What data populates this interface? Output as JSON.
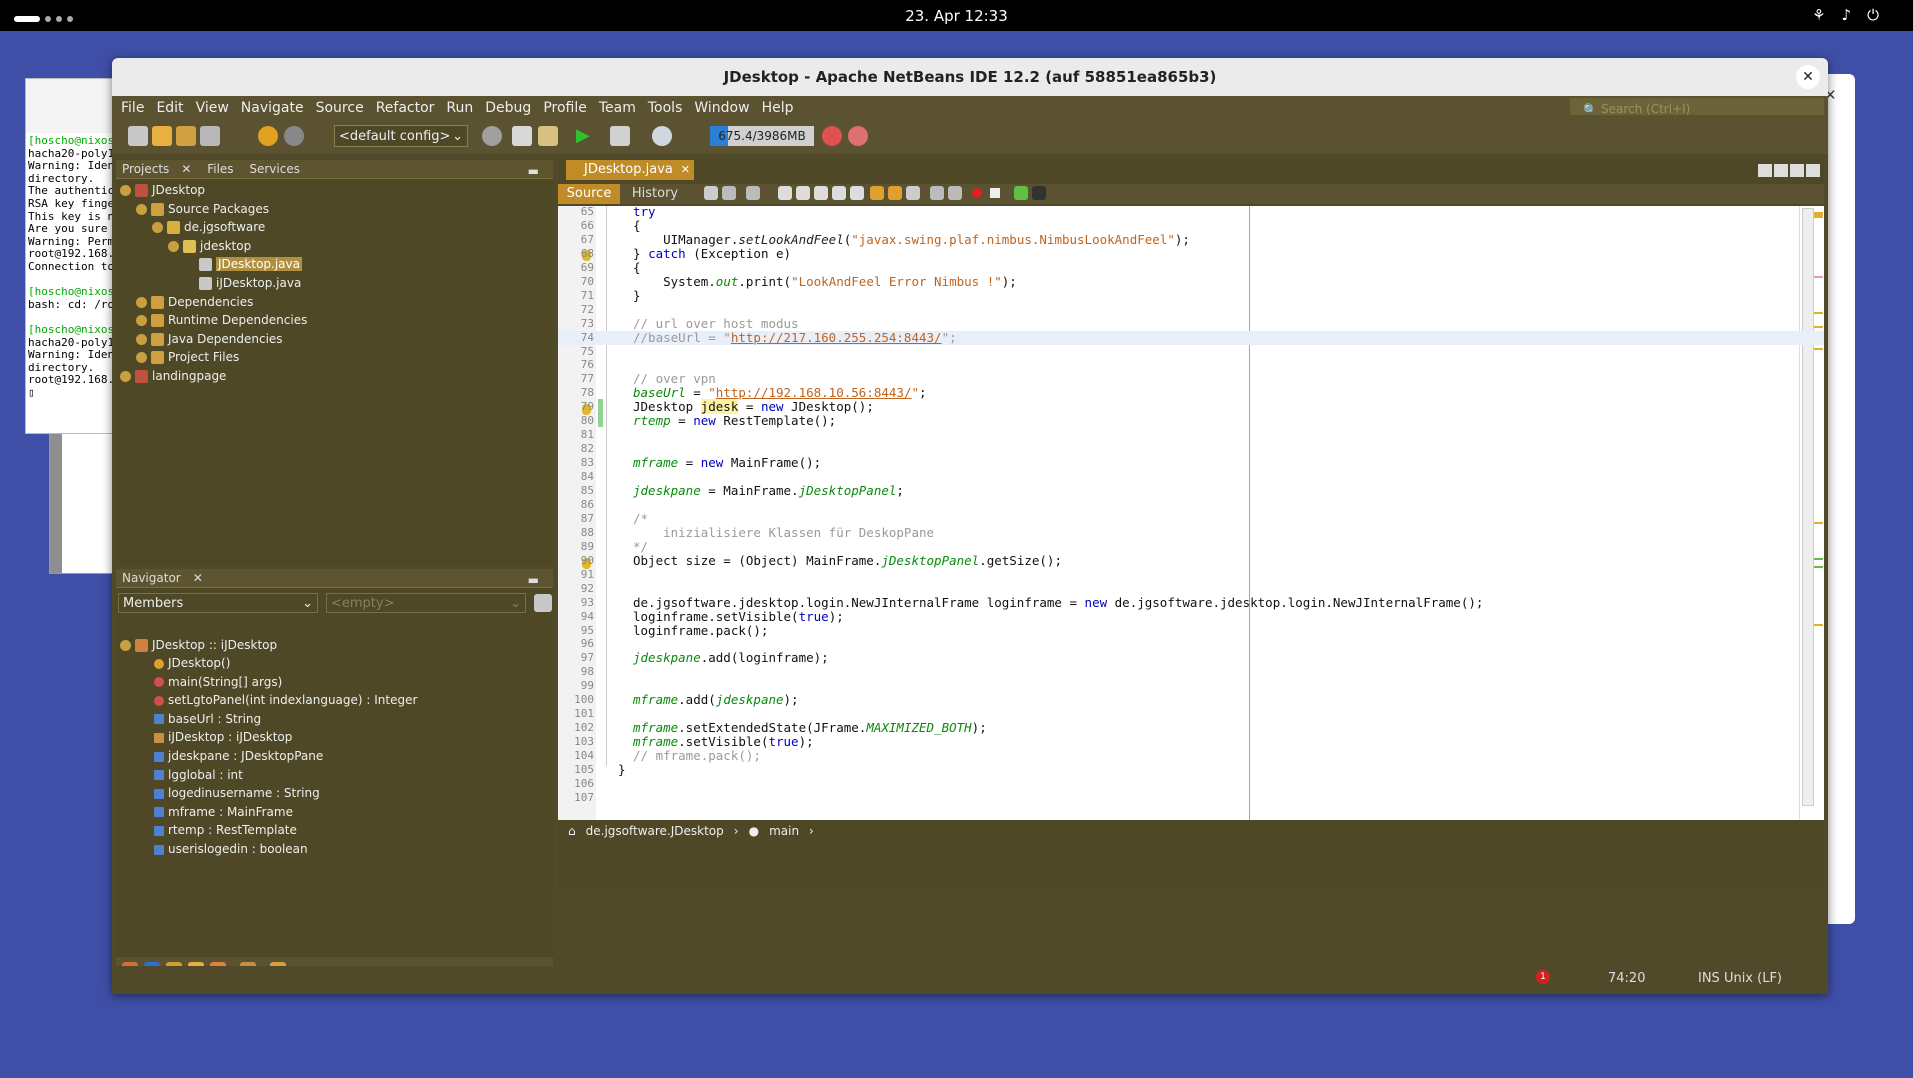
{
  "system_bar": {
    "clock": "23. Apr  12:33"
  },
  "terminal": {
    "lines": [
      {
        "text": "[hoscho@nixos:",
        "green": true
      },
      {
        "text": "hacha20-poly13",
        "green": false
      },
      {
        "text": "Warning: Ident",
        "green": false
      },
      {
        "text": "directory.",
        "green": false
      },
      {
        "text": "The authentici",
        "green": false
      },
      {
        "text": "RSA key finger",
        "green": false
      },
      {
        "text": "This key is no",
        "green": false
      },
      {
        "text": "Are you sure y",
        "green": false
      },
      {
        "text": "Warning: Perma",
        "green": false
      },
      {
        "text": "root@192.168.1",
        "green": false
      },
      {
        "text": "Connection to ",
        "green": false
      },
      {
        "text": "",
        "green": false
      },
      {
        "text": "[hoscho@nixos:",
        "green": true
      },
      {
        "text": "bash: cd: /roo",
        "green": false
      },
      {
        "text": "",
        "green": false
      },
      {
        "text": "[hoscho@nixos:",
        "green": true
      },
      {
        "text": "hacha20-poly13",
        "green": false
      },
      {
        "text": "Warning: Ident",
        "green": false
      },
      {
        "text": "directory.",
        "green": false
      },
      {
        "text": "root@192.168.1",
        "green": false
      },
      {
        "text": "▯",
        "green": false
      }
    ]
  },
  "window": {
    "title": "JDesktop - Apache NetBeans IDE 12.2 (auf 58851ea865b3)",
    "close": "✕"
  },
  "menu": [
    "File",
    "Edit",
    "View",
    "Navigate",
    "Source",
    "Refactor",
    "Run",
    "Debug",
    "Profile",
    "Team",
    "Tools",
    "Window",
    "Help"
  ],
  "search_placeholder": "Search (Ctrl+I)",
  "toolbar": {
    "config": "<default config>",
    "memory": "675.4/3986MB",
    "memory_used_fraction": 0.17
  },
  "projects_panel": {
    "tabs": [
      "Projects",
      "Files",
      "Services"
    ],
    "tree": [
      {
        "label": "JDesktop",
        "depth": 0,
        "selected": false
      },
      {
        "label": "Source Packages",
        "depth": 1,
        "selected": false
      },
      {
        "label": "de.jgsoftware",
        "depth": 2,
        "selected": false
      },
      {
        "label": "jdesktop",
        "depth": 3,
        "selected": false
      },
      {
        "label": "JDesktop.java",
        "depth": 4,
        "selected": true
      },
      {
        "label": "iJDesktop.java",
        "depth": 4,
        "selected": false
      },
      {
        "label": "Dependencies",
        "depth": 1,
        "selected": false
      },
      {
        "label": "Runtime Dependencies",
        "depth": 1,
        "selected": false
      },
      {
        "label": "Java Dependencies",
        "depth": 1,
        "selected": false
      },
      {
        "label": "Project Files",
        "depth": 1,
        "selected": false
      },
      {
        "label": "landingpage",
        "depth": 0,
        "selected": false
      }
    ]
  },
  "navigator": {
    "title": "Navigator",
    "filter": "Members",
    "scope": "<empty>",
    "root": "JDesktop :: iJDesktop",
    "members": [
      "JDesktop()",
      "main(String[] args)",
      "setLgtoPanel(int indexlanguage) : Integer",
      "baseUrl : String",
      "iJDesktop : iJDesktop",
      "jdeskpane : JDesktopPane",
      "lgglobal : int",
      "logedinusername : String",
      "mframe : MainFrame",
      "rtemp : RestTemplate",
      "userislogedin : boolean"
    ]
  },
  "editor": {
    "tab": "JDesktop.java",
    "source_label": "Source",
    "history_label": "History",
    "lines": [
      {
        "n": "65",
        "html": "<span class=\"kw\">try</span>"
      },
      {
        "n": "66",
        "html": "{"
      },
      {
        "n": "67",
        "html": "    UIManager.<span class=\"m\">setLookAndFeel</span>(<span class=\"s\">\"javax.swing.plaf.nimbus.NimbusLookAndFeel\"</span>);"
      },
      {
        "n": "68",
        "html": "} <span class=\"kw\">catch</span> (Exception e)"
      },
      {
        "n": "69",
        "html": "{"
      },
      {
        "n": "70",
        "html": "    System.<span class=\"f\">out</span>.print(<span class=\"s\">\"LookAndFeel Error Nimbus !\"</span>);"
      },
      {
        "n": "71",
        "html": "}"
      },
      {
        "n": "72",
        "html": ""
      },
      {
        "n": "73",
        "html": "<span class=\"c\">// url over host modus</span>"
      },
      {
        "n": "74",
        "html": "<span class=\"c\">//baseUrl = \"</span><span class=\"u\">http://217.160.255.254:8443/</span><span class=\"c\">\";</span>"
      },
      {
        "n": "75",
        "html": ""
      },
      {
        "n": "76",
        "html": ""
      },
      {
        "n": "77",
        "html": "<span class=\"c\">// over vpn</span>"
      },
      {
        "n": "78",
        "html": "<span class=\"f\">baseUrl</span> = <span class=\"s\">\"</span><span class=\"u\">http://192.168.10.56:8443/</span><span class=\"s\">\"</span>;"
      },
      {
        "n": "79",
        "html": "JDesktop <span class=\"y\">jdesk</span> = <span class=\"kw\">new</span> JDesktop();"
      },
      {
        "n": "80",
        "html": "<span class=\"f\">rtemp</span> = <span class=\"kw\">new</span> RestTemplate();"
      },
      {
        "n": "81",
        "html": ""
      },
      {
        "n": "82",
        "html": ""
      },
      {
        "n": "83",
        "html": "<span class=\"f\">mframe</span> = <span class=\"kw\">new</span> MainFrame();"
      },
      {
        "n": "84",
        "html": ""
      },
      {
        "n": "85",
        "html": "<span class=\"f\">jdeskpane</span> = MainFrame.<span class=\"f\">jDesktopPanel</span>;"
      },
      {
        "n": "86",
        "html": ""
      },
      {
        "n": "87",
        "html": "<span class=\"c\">/*</span>"
      },
      {
        "n": "88",
        "html": "<span class=\"c\">    inizialisiere Klassen für DeskopPane</span>"
      },
      {
        "n": "89",
        "html": "<span class=\"c\">*/</span>"
      },
      {
        "n": "90",
        "html": "Object size = (Object) MainFrame.<span class=\"f\">jDesktopPanel</span>.getSize();"
      },
      {
        "n": "91",
        "html": ""
      },
      {
        "n": "92",
        "html": ""
      },
      {
        "n": "93",
        "html": "de.jgsoftware.jdesktop.login.NewJInternalFrame loginframe = <span class=\"kw\">new</span> de.jgsoftware.jdesktop.login.NewJInternalFrame();"
      },
      {
        "n": "94",
        "html": "loginframe.setVisible(<span class=\"kw\">true</span>);"
      },
      {
        "n": "95",
        "html": "loginframe.pack();"
      },
      {
        "n": "96",
        "html": ""
      },
      {
        "n": "97",
        "html": "<span class=\"f\">jdeskpane</span>.add(loginframe);"
      },
      {
        "n": "98",
        "html": ""
      },
      {
        "n": "99",
        "html": ""
      },
      {
        "n": "100",
        "html": "<span class=\"f\">mframe</span>.add(<span class=\"f\">jdeskpane</span>);"
      },
      {
        "n": "101",
        "html": ""
      },
      {
        "n": "102",
        "html": "<span class=\"f\">mframe</span>.setExtendedState(JFrame.<span class=\"f\">MAXIMIZED_BOTH</span>);"
      },
      {
        "n": "103",
        "html": "<span class=\"f\">mframe</span>.setVisible(<span class=\"kw\">true</span>);"
      },
      {
        "n": "104",
        "html": "<span class=\"c\">// mframe.pack();</span>"
      },
      {
        "n": "105",
        "html": "}"
      },
      {
        "n": "106",
        "html": ""
      },
      {
        "n": "107",
        "html": ""
      }
    ],
    "breadcrumb": [
      "de.jgsoftware.JDesktop",
      "main"
    ]
  },
  "statusbar": {
    "notifications": "1",
    "position": "74:20",
    "mode": "INS  Unix (LF)"
  }
}
